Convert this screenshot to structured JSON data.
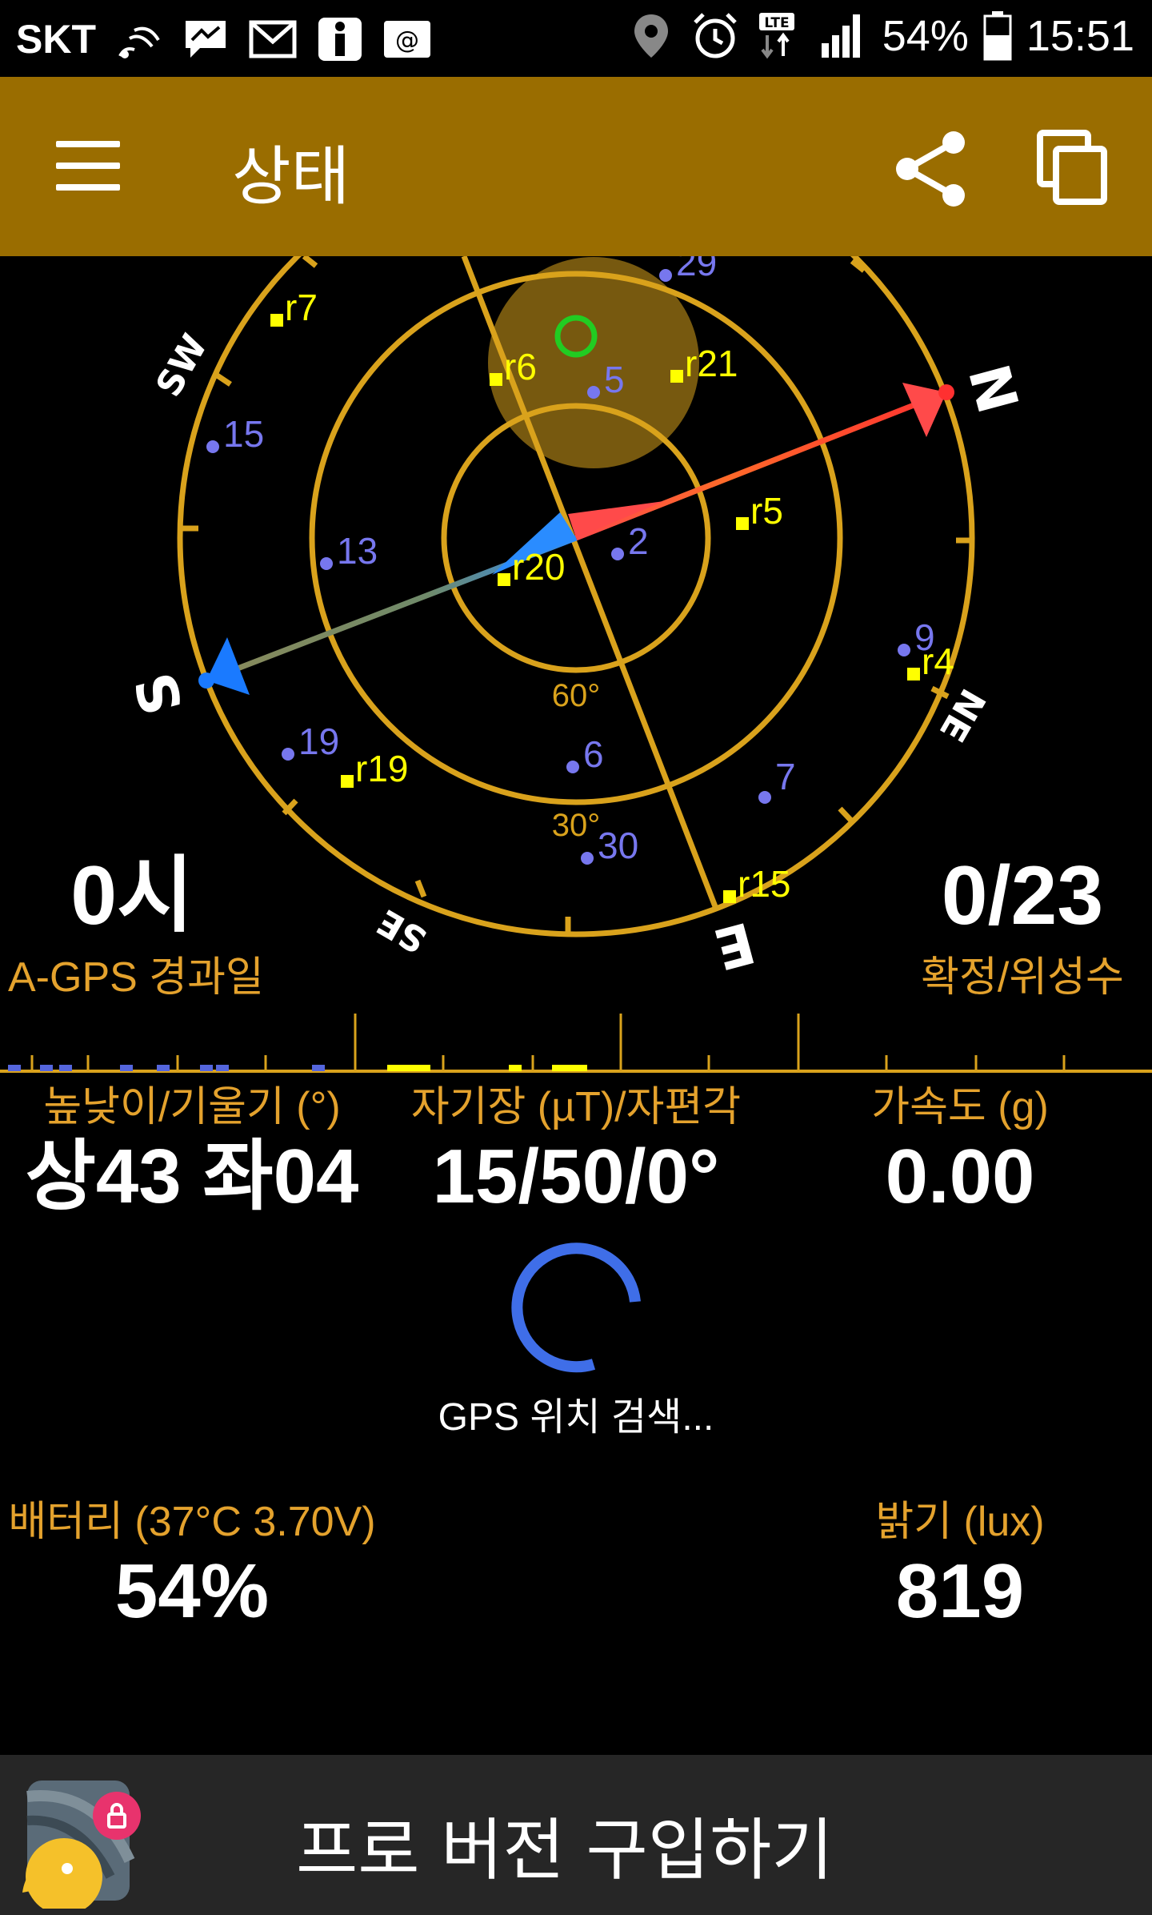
{
  "status_bar": {
    "carrier": "SKT",
    "battery": "54%",
    "time": "15:51",
    "network": "LTE",
    "icons": [
      "cast-icon",
      "messenger-icon",
      "gmail-icon",
      "info-app-icon",
      "email-icon",
      "location-icon",
      "alarm-icon",
      "lte-icon",
      "signal-icon",
      "battery-icon"
    ]
  },
  "app_bar": {
    "title": "상태",
    "icons": [
      "menu-icon",
      "share-icon",
      "copy-icon"
    ],
    "color": "#9a6d00"
  },
  "compass": {
    "directions": [
      "N",
      "NE",
      "E",
      "SE",
      "S",
      "SW"
    ],
    "elevation_labels": [
      "60°",
      "30°"
    ],
    "satellites_gps": [
      "29",
      "5",
      "15",
      "13",
      "2",
      "9",
      "19",
      "6",
      "7",
      "30"
    ],
    "satellites_glonass": [
      "r7",
      "r6",
      "r21",
      "r5",
      "r20",
      "r4",
      "r19",
      "r15"
    ],
    "ring_color": "#d9a21c",
    "gps_color": "#7777ee",
    "glonass_color": "#ffff00"
  },
  "agps": {
    "value": "0시",
    "label": "A-GPS 경과일"
  },
  "fix": {
    "value": "0/23",
    "label": "확정/위성수"
  },
  "tilt": {
    "label": "높낮이/기울기 (°)",
    "value": "상43 좌04"
  },
  "magnetic": {
    "label": "자기장 (µT)/자편각",
    "value": "15/50/0°"
  },
  "acceleration": {
    "label": "가속도 (g)",
    "value": "0.00"
  },
  "gps_status": "GPS 위치 검색...",
  "battery_info": {
    "label": "배터리 (37°C 3.70V)",
    "value": "54%"
  },
  "brightness": {
    "label": "밝기 (lux)",
    "value": "819"
  },
  "promo": {
    "label": "프로 버전 구입하기"
  }
}
